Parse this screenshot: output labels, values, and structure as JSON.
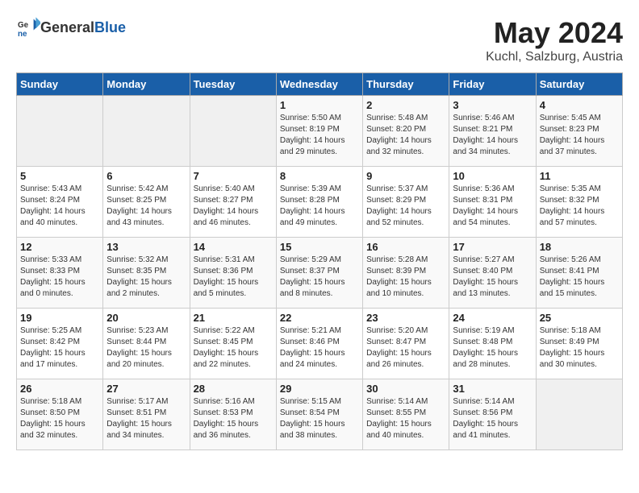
{
  "header": {
    "logo_general": "General",
    "logo_blue": "Blue",
    "title": "May 2024",
    "subtitle": "Kuchl, Salzburg, Austria"
  },
  "weekdays": [
    "Sunday",
    "Monday",
    "Tuesday",
    "Wednesday",
    "Thursday",
    "Friday",
    "Saturday"
  ],
  "weeks": [
    [
      {
        "day": "",
        "sunrise": "",
        "sunset": "",
        "daylight": "",
        "empty": true
      },
      {
        "day": "",
        "sunrise": "",
        "sunset": "",
        "daylight": "",
        "empty": true
      },
      {
        "day": "",
        "sunrise": "",
        "sunset": "",
        "daylight": "",
        "empty": true
      },
      {
        "day": "1",
        "sunrise": "Sunrise: 5:50 AM",
        "sunset": "Sunset: 8:19 PM",
        "daylight": "Daylight: 14 hours and 29 minutes."
      },
      {
        "day": "2",
        "sunrise": "Sunrise: 5:48 AM",
        "sunset": "Sunset: 8:20 PM",
        "daylight": "Daylight: 14 hours and 32 minutes."
      },
      {
        "day": "3",
        "sunrise": "Sunrise: 5:46 AM",
        "sunset": "Sunset: 8:21 PM",
        "daylight": "Daylight: 14 hours and 34 minutes."
      },
      {
        "day": "4",
        "sunrise": "Sunrise: 5:45 AM",
        "sunset": "Sunset: 8:23 PM",
        "daylight": "Daylight: 14 hours and 37 minutes."
      }
    ],
    [
      {
        "day": "5",
        "sunrise": "Sunrise: 5:43 AM",
        "sunset": "Sunset: 8:24 PM",
        "daylight": "Daylight: 14 hours and 40 minutes."
      },
      {
        "day": "6",
        "sunrise": "Sunrise: 5:42 AM",
        "sunset": "Sunset: 8:25 PM",
        "daylight": "Daylight: 14 hours and 43 minutes."
      },
      {
        "day": "7",
        "sunrise": "Sunrise: 5:40 AM",
        "sunset": "Sunset: 8:27 PM",
        "daylight": "Daylight: 14 hours and 46 minutes."
      },
      {
        "day": "8",
        "sunrise": "Sunrise: 5:39 AM",
        "sunset": "Sunset: 8:28 PM",
        "daylight": "Daylight: 14 hours and 49 minutes."
      },
      {
        "day": "9",
        "sunrise": "Sunrise: 5:37 AM",
        "sunset": "Sunset: 8:29 PM",
        "daylight": "Daylight: 14 hours and 52 minutes."
      },
      {
        "day": "10",
        "sunrise": "Sunrise: 5:36 AM",
        "sunset": "Sunset: 8:31 PM",
        "daylight": "Daylight: 14 hours and 54 minutes."
      },
      {
        "day": "11",
        "sunrise": "Sunrise: 5:35 AM",
        "sunset": "Sunset: 8:32 PM",
        "daylight": "Daylight: 14 hours and 57 minutes."
      }
    ],
    [
      {
        "day": "12",
        "sunrise": "Sunrise: 5:33 AM",
        "sunset": "Sunset: 8:33 PM",
        "daylight": "Daylight: 15 hours and 0 minutes."
      },
      {
        "day": "13",
        "sunrise": "Sunrise: 5:32 AM",
        "sunset": "Sunset: 8:35 PM",
        "daylight": "Daylight: 15 hours and 2 minutes."
      },
      {
        "day": "14",
        "sunrise": "Sunrise: 5:31 AM",
        "sunset": "Sunset: 8:36 PM",
        "daylight": "Daylight: 15 hours and 5 minutes."
      },
      {
        "day": "15",
        "sunrise": "Sunrise: 5:29 AM",
        "sunset": "Sunset: 8:37 PM",
        "daylight": "Daylight: 15 hours and 8 minutes."
      },
      {
        "day": "16",
        "sunrise": "Sunrise: 5:28 AM",
        "sunset": "Sunset: 8:39 PM",
        "daylight": "Daylight: 15 hours and 10 minutes."
      },
      {
        "day": "17",
        "sunrise": "Sunrise: 5:27 AM",
        "sunset": "Sunset: 8:40 PM",
        "daylight": "Daylight: 15 hours and 13 minutes."
      },
      {
        "day": "18",
        "sunrise": "Sunrise: 5:26 AM",
        "sunset": "Sunset: 8:41 PM",
        "daylight": "Daylight: 15 hours and 15 minutes."
      }
    ],
    [
      {
        "day": "19",
        "sunrise": "Sunrise: 5:25 AM",
        "sunset": "Sunset: 8:42 PM",
        "daylight": "Daylight: 15 hours and 17 minutes."
      },
      {
        "day": "20",
        "sunrise": "Sunrise: 5:23 AM",
        "sunset": "Sunset: 8:44 PM",
        "daylight": "Daylight: 15 hours and 20 minutes."
      },
      {
        "day": "21",
        "sunrise": "Sunrise: 5:22 AM",
        "sunset": "Sunset: 8:45 PM",
        "daylight": "Daylight: 15 hours and 22 minutes."
      },
      {
        "day": "22",
        "sunrise": "Sunrise: 5:21 AM",
        "sunset": "Sunset: 8:46 PM",
        "daylight": "Daylight: 15 hours and 24 minutes."
      },
      {
        "day": "23",
        "sunrise": "Sunrise: 5:20 AM",
        "sunset": "Sunset: 8:47 PM",
        "daylight": "Daylight: 15 hours and 26 minutes."
      },
      {
        "day": "24",
        "sunrise": "Sunrise: 5:19 AM",
        "sunset": "Sunset: 8:48 PM",
        "daylight": "Daylight: 15 hours and 28 minutes."
      },
      {
        "day": "25",
        "sunrise": "Sunrise: 5:18 AM",
        "sunset": "Sunset: 8:49 PM",
        "daylight": "Daylight: 15 hours and 30 minutes."
      }
    ],
    [
      {
        "day": "26",
        "sunrise": "Sunrise: 5:18 AM",
        "sunset": "Sunset: 8:50 PM",
        "daylight": "Daylight: 15 hours and 32 minutes."
      },
      {
        "day": "27",
        "sunrise": "Sunrise: 5:17 AM",
        "sunset": "Sunset: 8:51 PM",
        "daylight": "Daylight: 15 hours and 34 minutes."
      },
      {
        "day": "28",
        "sunrise": "Sunrise: 5:16 AM",
        "sunset": "Sunset: 8:53 PM",
        "daylight": "Daylight: 15 hours and 36 minutes."
      },
      {
        "day": "29",
        "sunrise": "Sunrise: 5:15 AM",
        "sunset": "Sunset: 8:54 PM",
        "daylight": "Daylight: 15 hours and 38 minutes."
      },
      {
        "day": "30",
        "sunrise": "Sunrise: 5:14 AM",
        "sunset": "Sunset: 8:55 PM",
        "daylight": "Daylight: 15 hours and 40 minutes."
      },
      {
        "day": "31",
        "sunrise": "Sunrise: 5:14 AM",
        "sunset": "Sunset: 8:56 PM",
        "daylight": "Daylight: 15 hours and 41 minutes."
      },
      {
        "day": "",
        "sunrise": "",
        "sunset": "",
        "daylight": "",
        "empty": true
      }
    ]
  ]
}
